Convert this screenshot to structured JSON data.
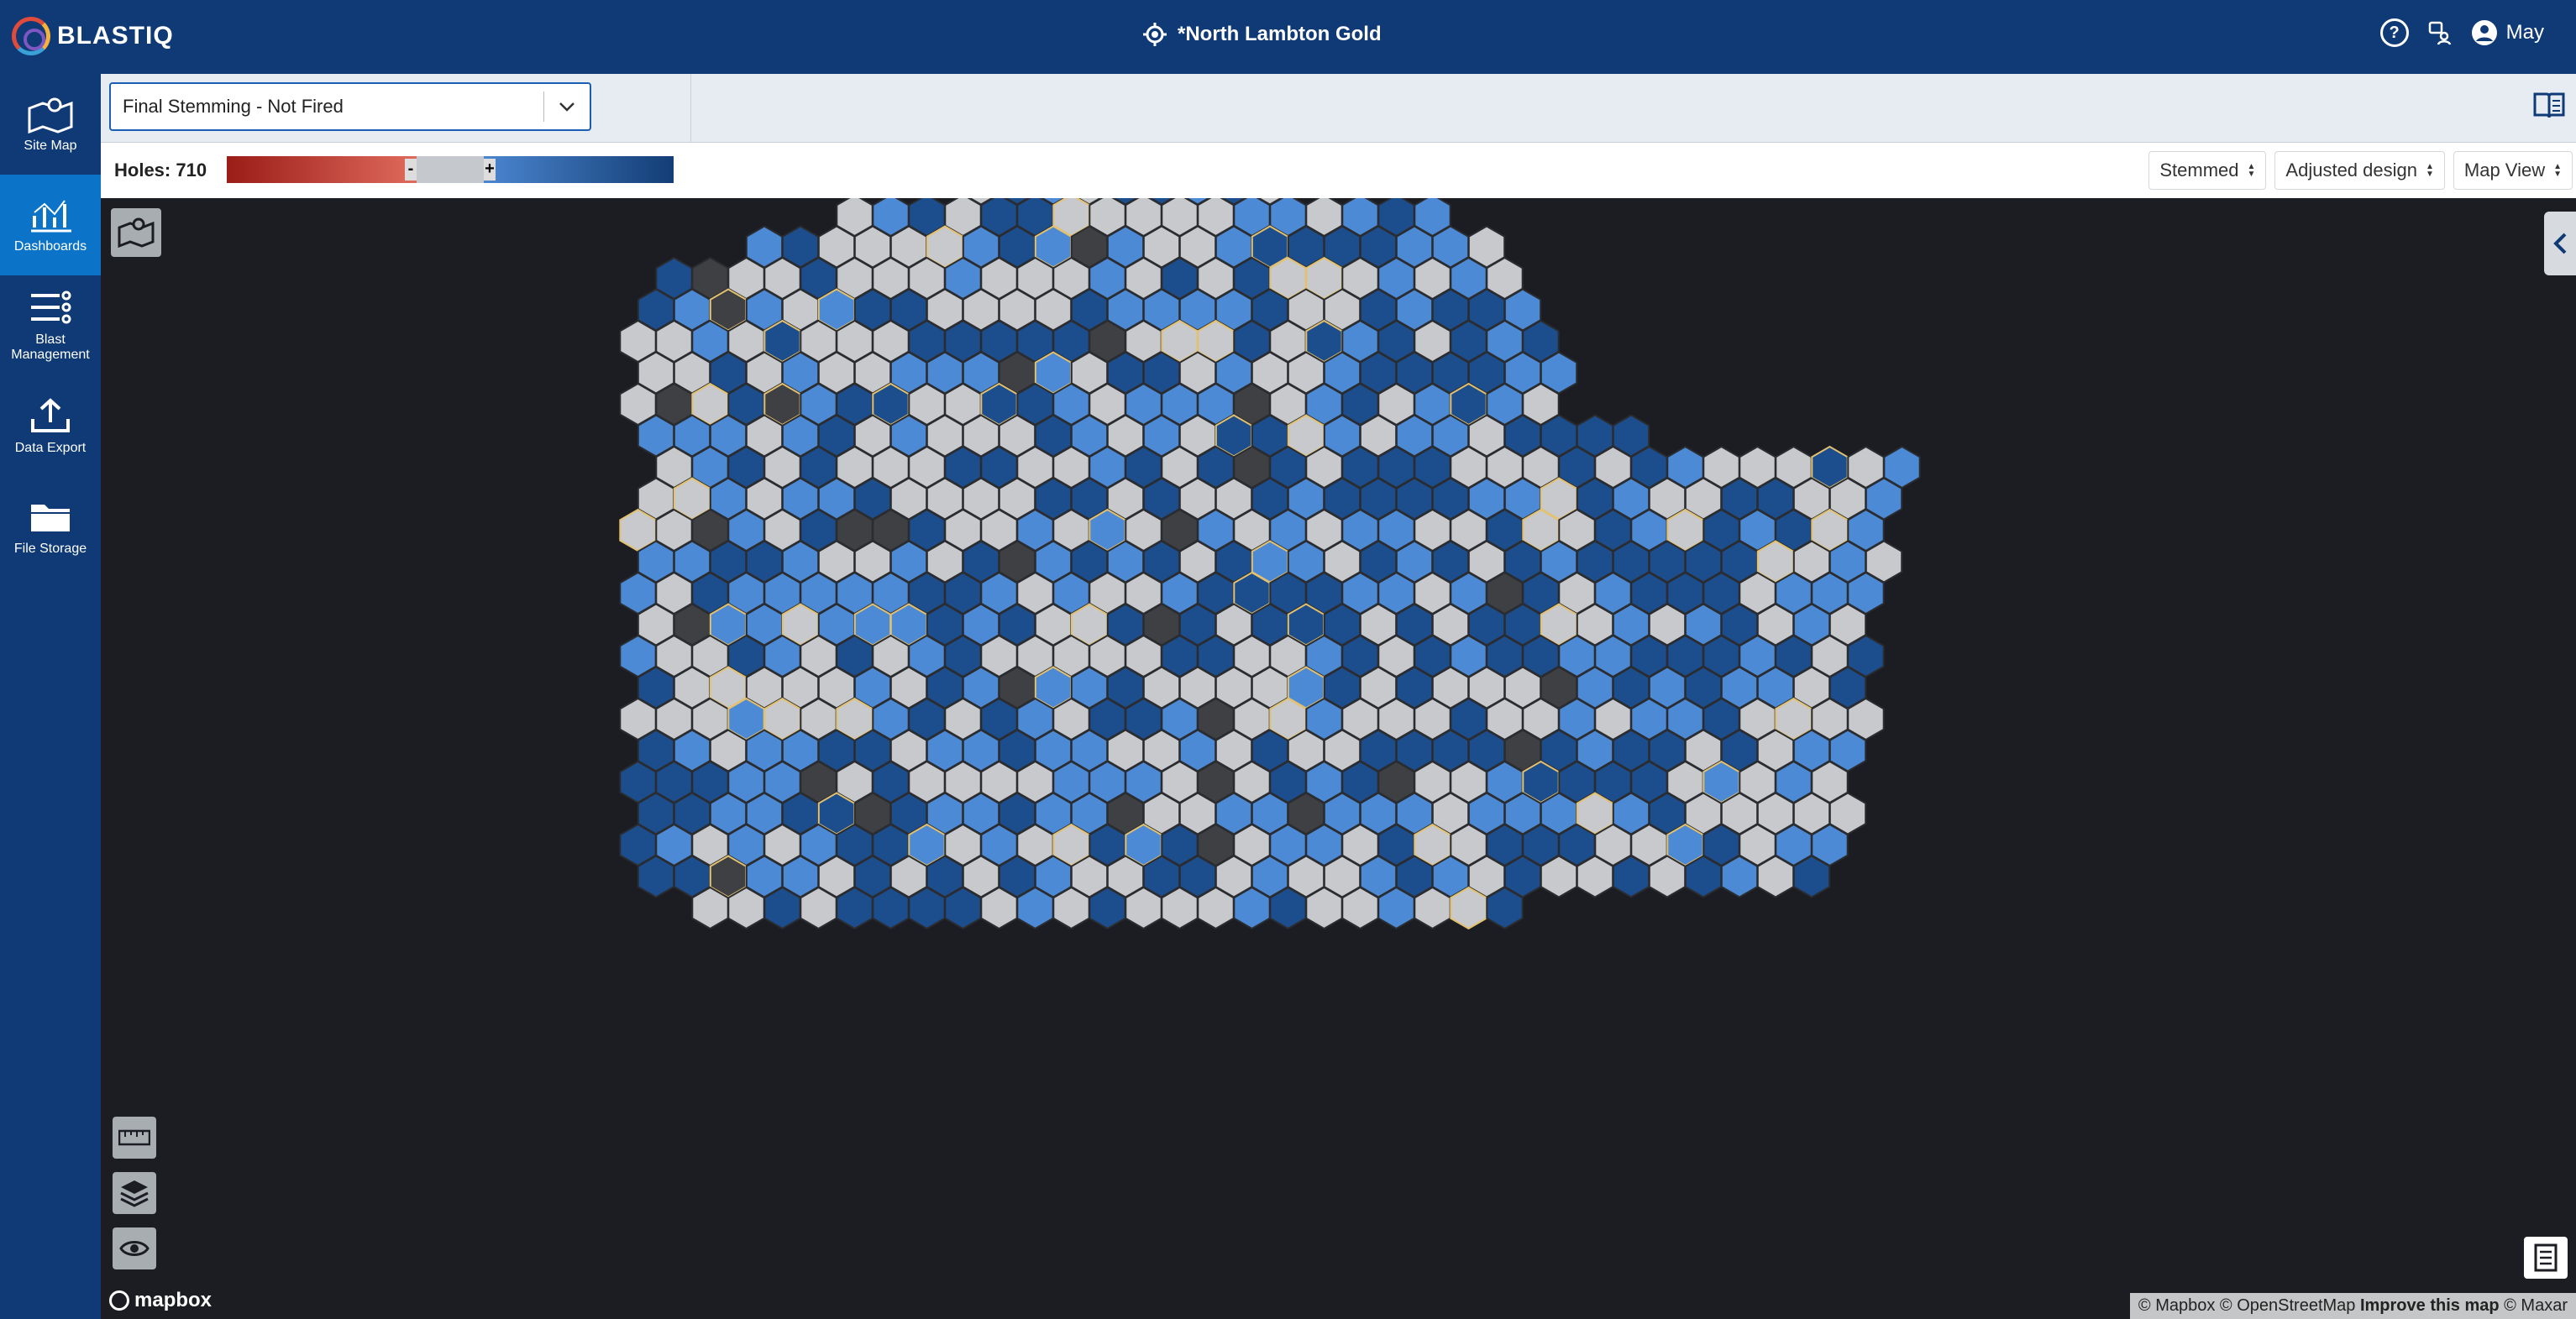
{
  "app": {
    "name": "BLASTIQ"
  },
  "header": {
    "site_title": "*North Lambton Gold",
    "user": "May"
  },
  "sidebar": {
    "items": [
      {
        "label": "Site Map",
        "icon": "site-map-icon"
      },
      {
        "label": "Dashboards",
        "icon": "dashboard-chart-icon",
        "active": true
      },
      {
        "label": "Blast Management",
        "icon": "blast-management-icon"
      },
      {
        "label": "Data Export",
        "icon": "upload-icon"
      },
      {
        "label": "File Storage",
        "icon": "folder-icon"
      }
    ]
  },
  "stage_select": {
    "value": "Final Stemming - Not Fired"
  },
  "legend": {
    "holes_label": "Holes: 710",
    "minus": "-",
    "plus": "+",
    "colors": {
      "neg_dark": "#9a1d17",
      "neg_light": "#e06a5c",
      "neutral": "#c5c8cc",
      "pos_light": "#4b86d0",
      "pos_dark": "#133d75"
    }
  },
  "dropdowns": {
    "metric": "Stemmed",
    "design": "Adjusted design",
    "view": "Map View"
  },
  "map": {
    "attribution": {
      "mapbox": "© Mapbox",
      "osm": "© OpenStreetMap",
      "improve": "Improve this map",
      "maxar": "© Maxar"
    },
    "logo": "mapbox",
    "hole_count": 710,
    "status_colors": {
      "stemmed_dark": "#1c4d8c",
      "stemmed_light": "#4c8ad6",
      "not_stemmed": "#c7c9cc",
      "missing": "#3e4044",
      "over": "#c4382c"
    }
  }
}
